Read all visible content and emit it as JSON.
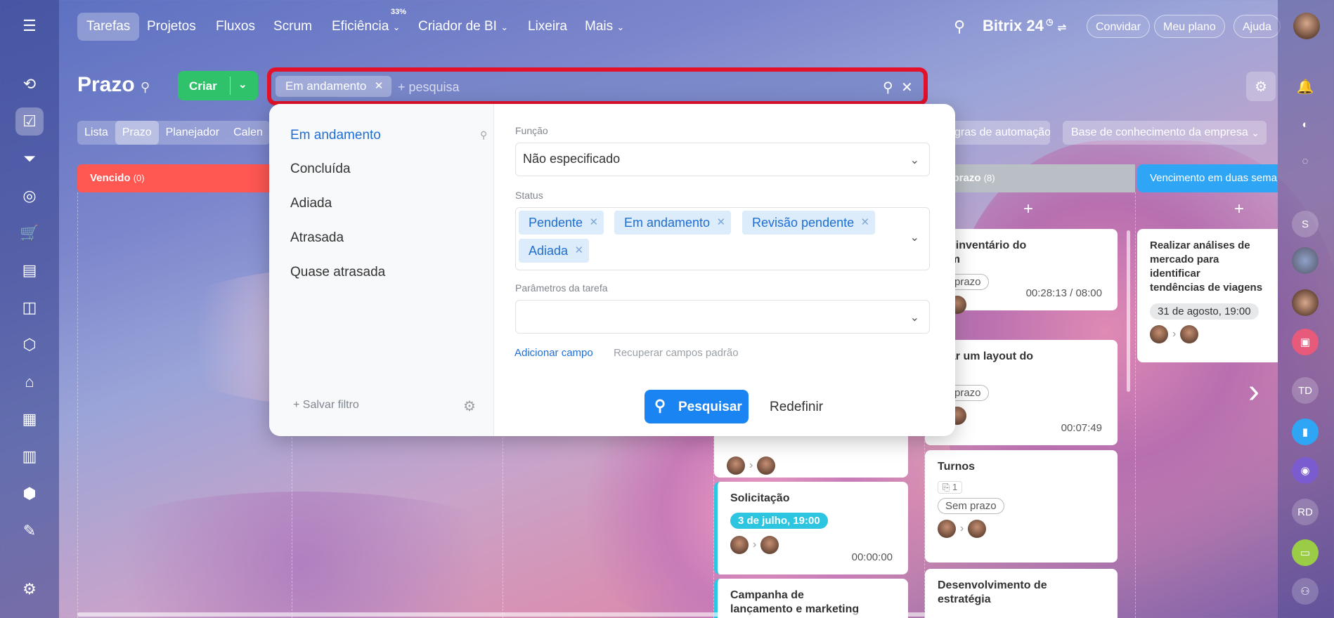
{
  "nav": {
    "items": [
      "Tarefas",
      "Projetos",
      "Fluxos",
      "Scrum",
      "Eficiência",
      "Criador de BI",
      "Lixeira",
      "Mais"
    ],
    "efficiency_badge": "33%",
    "brand": "Bitrix 24",
    "invite": "Convidar",
    "plan": "Meu plano",
    "help": "Ajuda"
  },
  "header": {
    "title": "Prazo",
    "create": "Criar",
    "search_chip": "Em andamento",
    "search_placeholder": "+ pesquisa"
  },
  "view_tabs": [
    "Lista",
    "Prazo",
    "Planejador",
    "Calen"
  ],
  "right_pills": [
    "gras de automação",
    "Base de conhecimento da empresa"
  ],
  "columns": {
    "overdue": {
      "title": "Vencido",
      "count": "(0)",
      "color": "#ff5752"
    },
    "no_deadline": {
      "title": "m prazo",
      "count": "(8)",
      "color": "#b9bfc5"
    },
    "two_weeks": {
      "title": "Vencimento em duas sema",
      "color": "#2fa6f5"
    }
  },
  "cards": {
    "c1": {
      "title": "er o inventário do\nazém",
      "tag": "em prazo",
      "time": "00:28:13 / 08:00"
    },
    "c2": {
      "title": "parar um layout do\neto",
      "tag": "em prazo",
      "time": "00:07:49"
    },
    "c3": {
      "title": "Turnos",
      "attach": "1",
      "tag": "Sem prazo"
    },
    "c4": {
      "title": "Desenvolvimento de\nestratégia"
    },
    "c5": {
      "title": "Realizar análises de\nmercado para identificar\ntendências de viagens e\npreferências dos clientes",
      "tag": "31 de agosto, 19:00"
    },
    "c6": {
      "title": "Solicitação",
      "tag": "3 de julho, 19:00",
      "time": "00:00:00"
    },
    "c7": {
      "title": "Campanha de\nlançamento e marketing"
    }
  },
  "filter": {
    "presets": [
      "Em andamento",
      "Concluída",
      "Adiada",
      "Atrasada",
      "Quase atrasada"
    ],
    "save_filter": "Salvar filtro",
    "role_label": "Função",
    "role_value": "Não especificado",
    "status_label": "Status",
    "status_tags": [
      "Pendente",
      "Em andamento",
      "Revisão pendente",
      "Adiada"
    ],
    "params_label": "Parâmetros da tarefa",
    "add_field": "Adicionar campo",
    "restore_fields": "Recuperar campos padrão",
    "search_button": "Pesquisar",
    "reset_button": "Redefinir"
  },
  "right_sidebar": {
    "avatars": [
      "S",
      "TD",
      "RD"
    ]
  },
  "colors": {
    "accent": "#1a84f2",
    "create": "#2fc26b",
    "highlight": "#e4112a"
  }
}
